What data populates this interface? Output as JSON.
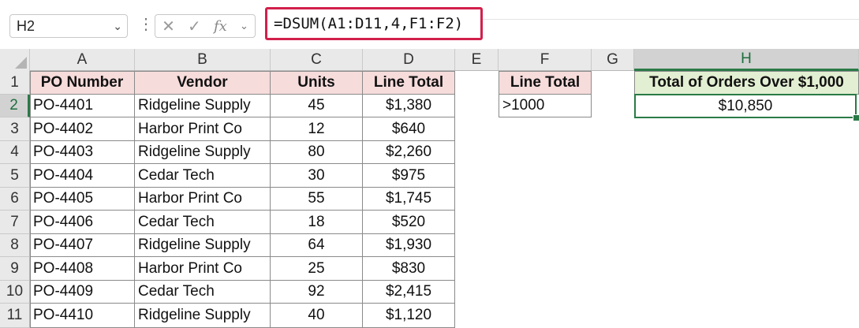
{
  "name_box": "H2",
  "formula": "=DSUM(A1:D11,4,F1:F2)",
  "fx_label": "fx",
  "columns": [
    "A",
    "B",
    "C",
    "D",
    "E",
    "F",
    "G",
    "H"
  ],
  "rows": [
    "1",
    "2",
    "3",
    "4",
    "5",
    "6",
    "7",
    "8",
    "9",
    "10",
    "11"
  ],
  "table": {
    "headers": [
      "PO Number",
      "Vendor",
      "Units",
      "Line Total"
    ],
    "rows": [
      [
        "PO-4401",
        "Ridgeline Supply",
        "45",
        "$1,380"
      ],
      [
        "PO-4402",
        "Harbor Print Co",
        "12",
        "$640"
      ],
      [
        "PO-4403",
        "Ridgeline Supply",
        "80",
        "$2,260"
      ],
      [
        "PO-4404",
        "Cedar Tech",
        "30",
        "$975"
      ],
      [
        "PO-4405",
        "Harbor Print Co",
        "55",
        "$1,745"
      ],
      [
        "PO-4406",
        "Cedar Tech",
        "18",
        "$520"
      ],
      [
        "PO-4407",
        "Ridgeline Supply",
        "64",
        "$1,930"
      ],
      [
        "PO-4408",
        "Harbor Print Co",
        "25",
        "$830"
      ],
      [
        "PO-4409",
        "Cedar Tech",
        "92",
        "$2,415"
      ],
      [
        "PO-4410",
        "Ridgeline Supply",
        "40",
        "$1,120"
      ]
    ]
  },
  "criteria": {
    "header": "Line Total",
    "value": ">1000"
  },
  "result": {
    "header": "Total of Orders Over $1,000",
    "value": "$10,850"
  },
  "colors": {
    "accent": "#d2204b",
    "selection": "#2a7a47",
    "header_pink": "#f7dcdc",
    "header_green": "#e3efd2"
  }
}
